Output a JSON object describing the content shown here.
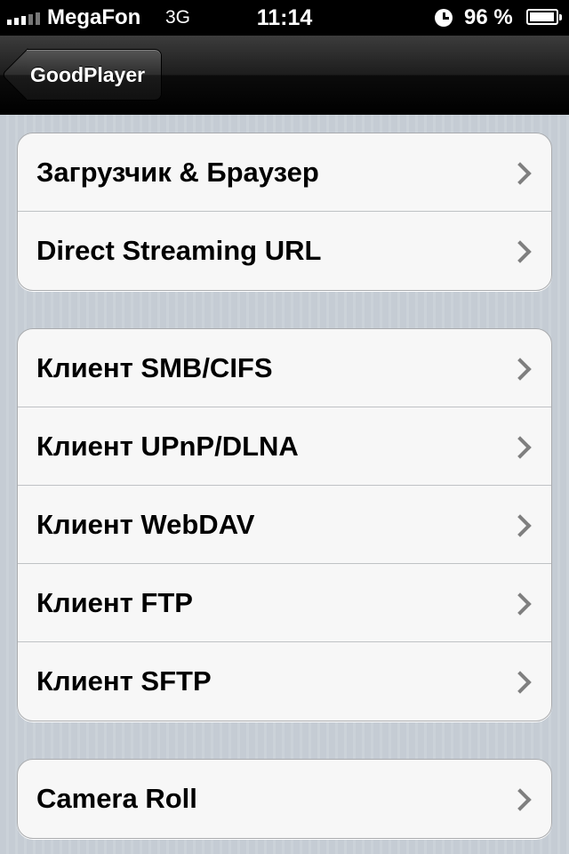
{
  "status_bar": {
    "carrier": "MegaFon",
    "network": "3G",
    "time": "11:14",
    "battery_percent_text": "96 %",
    "battery_level": 0.96
  },
  "nav_bar": {
    "back_label": "GoodPlayer"
  },
  "groups": [
    {
      "items": [
        {
          "label": "Загрузчик & Браузер"
        },
        {
          "label": "Direct Streaming URL"
        }
      ]
    },
    {
      "items": [
        {
          "label": "Клиент SMB/CIFS"
        },
        {
          "label": "Клиент UPnP/DLNA"
        },
        {
          "label": "Клиент WebDAV"
        },
        {
          "label": "Клиент FTP"
        },
        {
          "label": "Клиент SFTP"
        }
      ]
    },
    {
      "items": [
        {
          "label": "Camera Roll"
        }
      ]
    }
  ]
}
